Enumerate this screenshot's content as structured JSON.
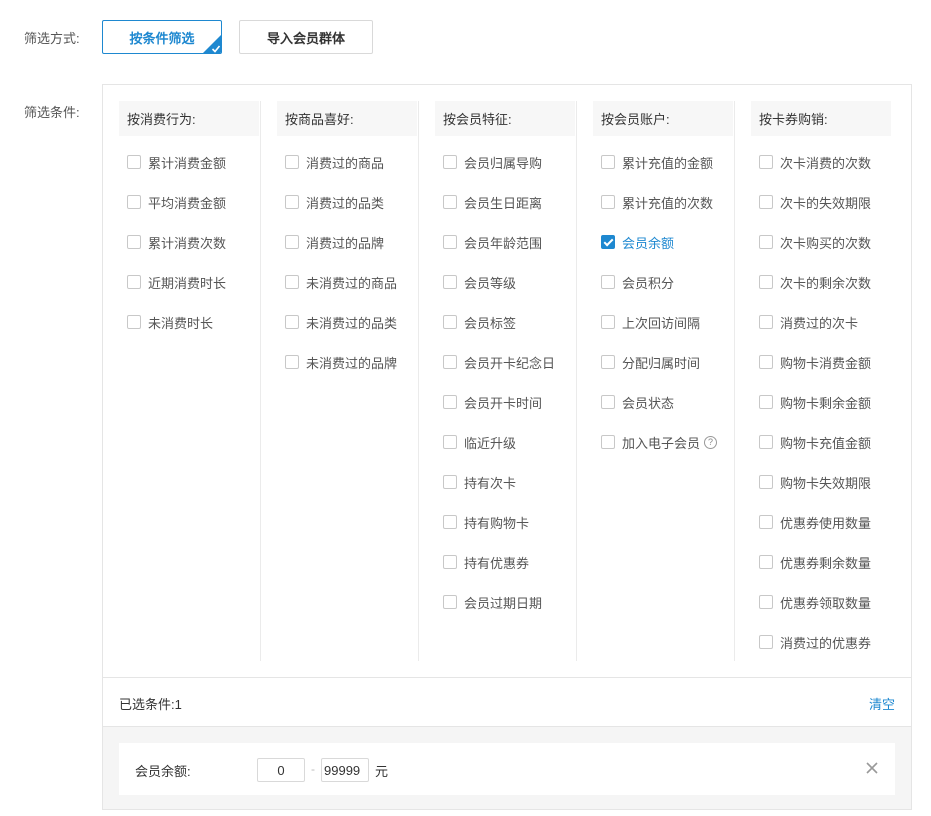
{
  "filter_mode": {
    "label": "筛选方式:",
    "options": [
      "按条件筛选",
      "导入会员群体"
    ],
    "selected": "按条件筛选"
  },
  "conditions_label": "筛选条件:",
  "columns": [
    {
      "header": "按消费行为:",
      "items": [
        {
          "label": "累计消费金额",
          "checked": false
        },
        {
          "label": "平均消费金额",
          "checked": false
        },
        {
          "label": "累计消费次数",
          "checked": false
        },
        {
          "label": "近期消费时长",
          "checked": false
        },
        {
          "label": "未消费时长",
          "checked": false
        }
      ]
    },
    {
      "header": "按商品喜好:",
      "items": [
        {
          "label": "消费过的商品",
          "checked": false
        },
        {
          "label": "消费过的品类",
          "checked": false
        },
        {
          "label": "消费过的品牌",
          "checked": false
        },
        {
          "label": "未消费过的商品",
          "checked": false
        },
        {
          "label": "未消费过的品类",
          "checked": false
        },
        {
          "label": "未消费过的品牌",
          "checked": false
        }
      ]
    },
    {
      "header": "按会员特征:",
      "items": [
        {
          "label": "会员归属导购",
          "checked": false
        },
        {
          "label": "会员生日距离",
          "checked": false
        },
        {
          "label": "会员年龄范围",
          "checked": false
        },
        {
          "label": "会员等级",
          "checked": false
        },
        {
          "label": "会员标签",
          "checked": false
        },
        {
          "label": "会员开卡纪念日",
          "checked": false
        },
        {
          "label": "会员开卡时间",
          "checked": false
        },
        {
          "label": "临近升级",
          "checked": false
        },
        {
          "label": "持有次卡",
          "checked": false
        },
        {
          "label": "持有购物卡",
          "checked": false
        },
        {
          "label": "持有优惠券",
          "checked": false
        },
        {
          "label": "会员过期日期",
          "checked": false
        }
      ]
    },
    {
      "header": "按会员账户:",
      "items": [
        {
          "label": "累计充值的金额",
          "checked": false
        },
        {
          "label": "累计充值的次数",
          "checked": false
        },
        {
          "label": "会员余额",
          "checked": true
        },
        {
          "label": "会员积分",
          "checked": false
        },
        {
          "label": "上次回访间隔",
          "checked": false
        },
        {
          "label": "分配归属时间",
          "checked": false
        },
        {
          "label": "会员状态",
          "checked": false
        },
        {
          "label": "加入电子会员",
          "checked": false,
          "help": "?"
        }
      ]
    },
    {
      "header": "按卡券购销:",
      "items": [
        {
          "label": "次卡消费的次数",
          "checked": false
        },
        {
          "label": "次卡的失效期限",
          "checked": false
        },
        {
          "label": "次卡购买的次数",
          "checked": false
        },
        {
          "label": "次卡的剩余次数",
          "checked": false
        },
        {
          "label": "消费过的次卡",
          "checked": false
        },
        {
          "label": "购物卡消费金额",
          "checked": false
        },
        {
          "label": "购物卡剩余金额",
          "checked": false
        },
        {
          "label": "购物卡充值金额",
          "checked": false
        },
        {
          "label": "购物卡失效期限",
          "checked": false
        },
        {
          "label": "优惠券使用数量",
          "checked": false
        },
        {
          "label": "优惠券剩余数量",
          "checked": false
        },
        {
          "label": "优惠券领取数量",
          "checked": false
        },
        {
          "label": "消费过的优惠券",
          "checked": false
        }
      ]
    }
  ],
  "selected_summary": {
    "text": "已选条件:1",
    "clear_label": "清空"
  },
  "selected_conditions": [
    {
      "label": "会员余额:",
      "min": "0",
      "max": "99999",
      "unit": "元"
    }
  ],
  "colors": {
    "accent": "#1e88d0"
  }
}
